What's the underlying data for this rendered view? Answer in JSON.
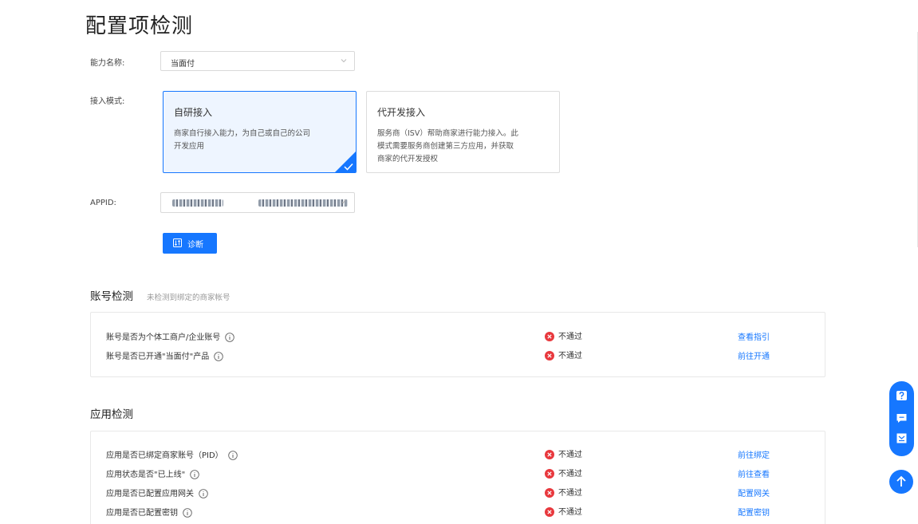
{
  "page": {
    "title": "配置项检测"
  },
  "form": {
    "capability_label": "能力名称:",
    "capability_value": "当面付",
    "mode_label": "接入模式:",
    "modes": [
      {
        "title": "自研接入",
        "desc_lines": [
          "商家自行接入能力，为自己或自己的公司",
          "开发应用"
        ],
        "selected": true
      },
      {
        "title": "代开发接入",
        "desc_lines": [
          "服务商（ISV）帮助商家进行能力接入。此",
          "模式需要服务商创建第三方应用，并获取",
          "商家的代开发授权"
        ],
        "selected": false
      }
    ],
    "appid_label": "APPID:",
    "diagnose_label": "诊断"
  },
  "account_check": {
    "title": "账号检测",
    "subtitle": "未检测到绑定的商家帐号",
    "rows": [
      {
        "question": "账号是否为个体工商户/企业账号",
        "status": "不通过",
        "action": "查看指引"
      },
      {
        "question": "账号是否已开通\"当面付\"产品",
        "status": "不通过",
        "action": "前往开通"
      }
    ]
  },
  "app_check": {
    "title": "应用检测",
    "rows": [
      {
        "question": "应用是否已绑定商家账号（PID）",
        "status": "不通过",
        "action": "前往绑定"
      },
      {
        "question": "应用状态是否\"已上线\"",
        "status": "不通过",
        "action": "前往查看"
      },
      {
        "question": "应用是否已配置应用网关",
        "status": "不通过",
        "action": "配置网关"
      },
      {
        "question": "应用是否已配置密钥",
        "status": "不通过",
        "action": "配置密钥"
      }
    ]
  },
  "colors": {
    "primary": "#1677ff",
    "fail": "#e8383d",
    "selected_bg": "#eef5ff"
  },
  "icons": [
    "chevron-down-icon",
    "check-corner-icon",
    "diagnose-icon",
    "info-icon",
    "fail-icon",
    "help-icon",
    "chat-icon",
    "feedback-icon",
    "back-to-top-icon"
  ]
}
